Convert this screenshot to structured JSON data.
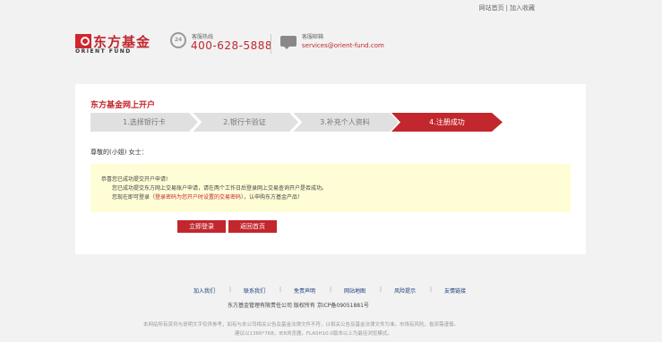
{
  "topbar": {
    "home_link": "网站首页",
    "separator": "|",
    "favorite_link": "加入收藏"
  },
  "header": {
    "logo_cn": "东方基金",
    "logo_en": "ORIENT FUND",
    "hotline_label": "客服热线",
    "hotline_number": "400-628-5888",
    "phone_icon_text": "24",
    "mail_label": "客服邮箱",
    "mail_address": "services@orient-fund.com"
  },
  "main": {
    "title": "东方基金网上开户",
    "steps": [
      {
        "label": "1.选择银行卡",
        "active": false
      },
      {
        "label": "2.银行卡验证",
        "active": false
      },
      {
        "label": "3.补充个人资料",
        "active": false
      },
      {
        "label": "4.注册成功",
        "active": true
      }
    ],
    "greeting": "尊敬的(小姐) 女士：",
    "notice": {
      "line1": "恭喜您已成功提交开户申请!",
      "line2": "您已成功提交东方网上交易账户申请，请在两个工作日后登录网上交易查询开户是否成功。",
      "line3_prefix": "您现在即可登录（",
      "line3_highlight": "登录密码为您开户时设置的交易密码",
      "line3_suffix": "），认申购东方基金产品！"
    },
    "buttons": {
      "login": "立即登录",
      "home": "返回首页"
    }
  },
  "footer": {
    "links": [
      "加入我们",
      "联系我们",
      "免责声明",
      "网站地图",
      "风险提示",
      "友情链接"
    ],
    "separator": "|",
    "company": "东方基金管理有限责任公司  版权所有  京ICP备09051881号",
    "note1": "本网站所有资讯与说明文字仅供参考，如有与本公司相关公告及基金法律文件不符，以相关公告及基金法律文件为准。市场有风险，投资需谨慎。",
    "note2": "建议以1366*768，IE8浏览器，FLASH10.0版本以上为最佳浏览模式。"
  },
  "colors": {
    "brand_red": "#c1272d",
    "step_inactive": "#e0e0e0",
    "notice_bg": "#fffdd6",
    "page_bg": "#f2f2f2"
  }
}
